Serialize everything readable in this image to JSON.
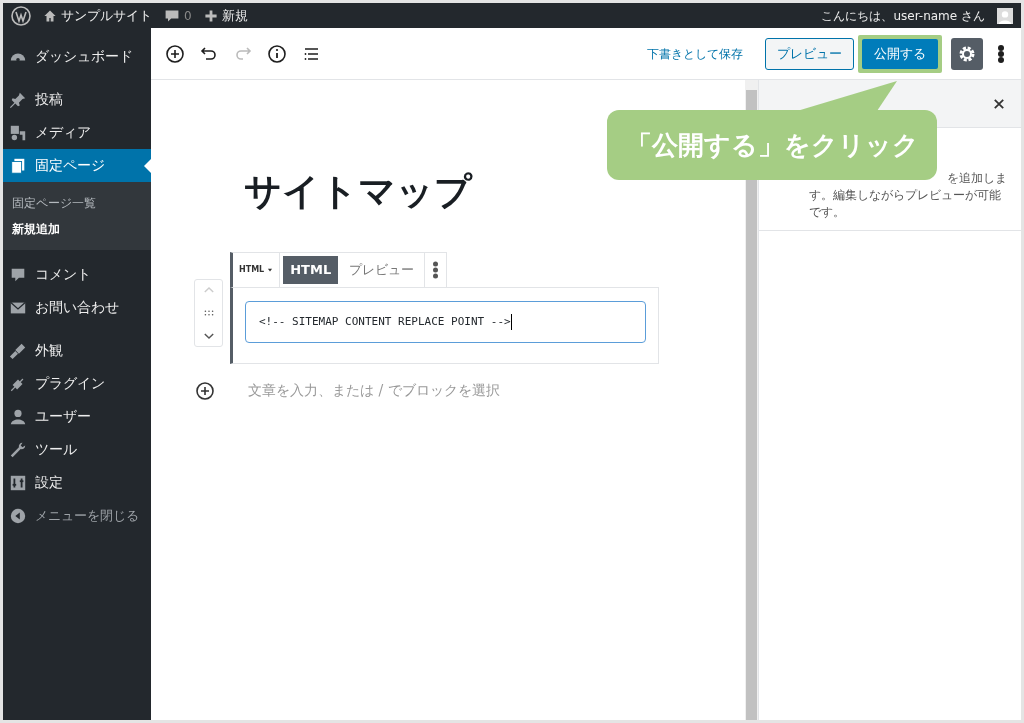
{
  "admin_bar": {
    "site_name": "サンプルサイト",
    "comments_count": "0",
    "new_label": "新規",
    "greeting": "こんにちは、user-name さん"
  },
  "sidebar": {
    "groups": [
      [
        {
          "label": "ダッシュボード",
          "selected": false
        }
      ],
      [
        {
          "label": "投稿",
          "selected": false
        },
        {
          "label": "メディア",
          "selected": false
        },
        {
          "label": "固定ページ",
          "selected": true,
          "children": [
            {
              "label": "固定ページ一覧",
              "selected": false
            },
            {
              "label": "新規追加",
              "selected": true
            }
          ]
        },
        {
          "label": "コメント",
          "selected": false
        },
        {
          "label": "お問い合わせ",
          "selected": false
        }
      ],
      [
        {
          "label": "外観",
          "selected": false
        },
        {
          "label": "プラグイン",
          "selected": false
        },
        {
          "label": "ユーザー",
          "selected": false
        },
        {
          "label": "ツール",
          "selected": false
        },
        {
          "label": "設定",
          "selected": false
        }
      ]
    ],
    "collapse_label": "メニューを閉じる"
  },
  "toolbar": {
    "save_draft": "下書きとして保存",
    "preview": "プレビュー",
    "publish": "公開する",
    "settings_selected": true
  },
  "editor": {
    "title": "サイトマップ",
    "block": {
      "type_label": "HTML",
      "tabs": [
        {
          "label": "HTML",
          "selected": true
        },
        {
          "label": "プレビュー",
          "selected": false
        }
      ],
      "code": "<!-- SITEMAP CONTENT REPLACE POINT -->"
    },
    "placeholder": "文章を入力、または / でブロックを選択"
  },
  "settings_panel": {
    "description": [
      "を追加しま",
      "す。編集しながらプレビューが可能",
      "です。"
    ]
  },
  "callout": "「公開する」をクリック"
}
